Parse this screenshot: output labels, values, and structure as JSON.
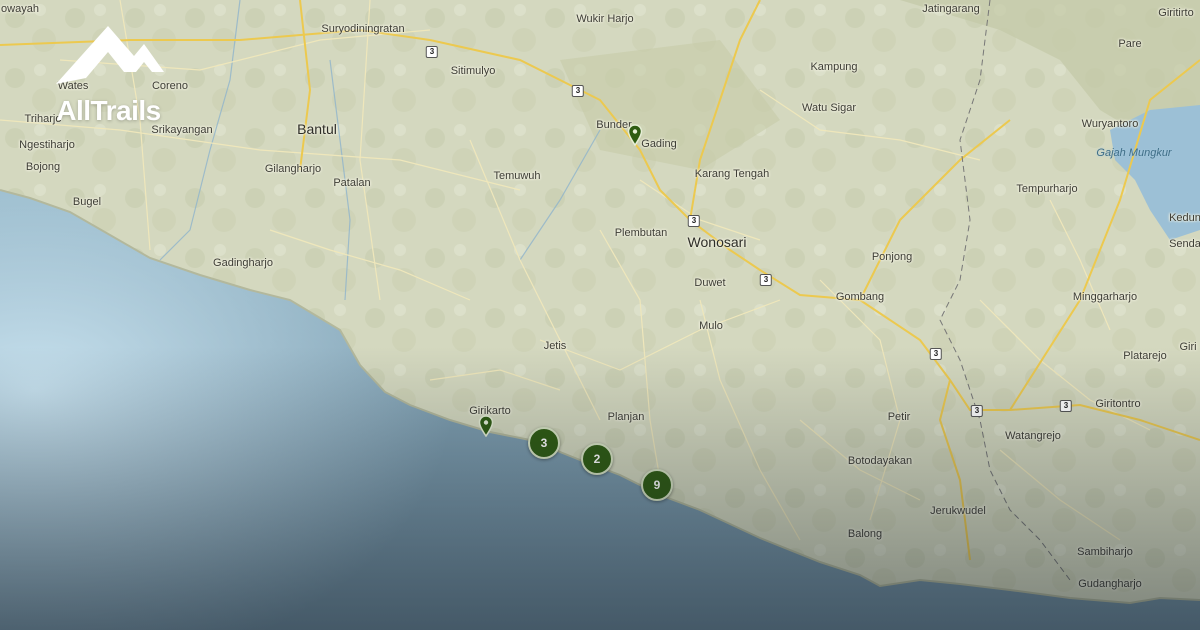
{
  "brand": {
    "name": "AllTrails",
    "logo_icon": "mountain-logo-icon"
  },
  "colors": {
    "ocean": "#8fb6c8",
    "land": "#d8dcc4",
    "road_major": "#f0cf5a",
    "road_minor": "#efe6b8",
    "cluster": "#2f5c12",
    "brand": "#ffffff"
  },
  "places": [
    {
      "id": "suryodiningratan",
      "name": "Suryodiningratan"
    },
    {
      "id": "wukir-harjo",
      "name": "Wukir Harjo"
    },
    {
      "id": "jatingarang",
      "name": "Jatingarang"
    },
    {
      "id": "giritirto",
      "name": "Giritirto"
    },
    {
      "id": "wates",
      "name": "Wates"
    },
    {
      "id": "coreno",
      "name": "Coreno"
    },
    {
      "id": "sitimulyo",
      "name": "Sitimulyo"
    },
    {
      "id": "kampung",
      "name": "Kampung"
    },
    {
      "id": "pare",
      "name": "Pare"
    },
    {
      "id": "triharjo",
      "name": "Triharjo"
    },
    {
      "id": "srikayangan",
      "name": "Srikayangan"
    },
    {
      "id": "bantul",
      "name": "Bantul",
      "big": true
    },
    {
      "id": "watu-sigar",
      "name": "Watu Sigar"
    },
    {
      "id": "bunder",
      "name": "Bunder"
    },
    {
      "id": "gading",
      "name": "Gading"
    },
    {
      "id": "wuryantoro",
      "name": "Wuryantoro"
    },
    {
      "id": "ngestiharjo",
      "name": "Ngestiharjo"
    },
    {
      "id": "gajah-mungkur",
      "name": "Gajah Mungkur",
      "water": true
    },
    {
      "id": "bojong",
      "name": "Bojong"
    },
    {
      "id": "gilangharjo",
      "name": "Gilangharjo"
    },
    {
      "id": "temuwuh",
      "name": "Temuwuh"
    },
    {
      "id": "karang-tengah",
      "name": "Karang Tengah"
    },
    {
      "id": "patalan",
      "name": "Patalan"
    },
    {
      "id": "tempurharjo",
      "name": "Tempurharjo"
    },
    {
      "id": "bugel",
      "name": "Bugel"
    },
    {
      "id": "kedung",
      "name": "Kedun"
    },
    {
      "id": "plembutan",
      "name": "Plembutan"
    },
    {
      "id": "wonosari",
      "name": "Wonosari",
      "big": true
    },
    {
      "id": "senda",
      "name": "Senda"
    },
    {
      "id": "gadingharjo",
      "name": "Gadingharjo"
    },
    {
      "id": "ponjong",
      "name": "Ponjong"
    },
    {
      "id": "duwet",
      "name": "Duwet"
    },
    {
      "id": "gombang",
      "name": "Gombang"
    },
    {
      "id": "minggarharjo",
      "name": "Minggarharjo"
    },
    {
      "id": "mulo",
      "name": "Mulo"
    },
    {
      "id": "jetis",
      "name": "Jetis"
    },
    {
      "id": "platarejo",
      "name": "Platarejo"
    },
    {
      "id": "giri",
      "name": "Giri"
    },
    {
      "id": "giritontro",
      "name": "Giritontro"
    },
    {
      "id": "girikarto",
      "name": "Girikarto"
    },
    {
      "id": "planjan",
      "name": "Planjan"
    },
    {
      "id": "petir",
      "name": "Petir"
    },
    {
      "id": "watangrejo",
      "name": "Watangrejo"
    },
    {
      "id": "botodayakan",
      "name": "Botodayakan"
    },
    {
      "id": "jerukwudel",
      "name": "Jerukwudel"
    },
    {
      "id": "balong",
      "name": "Balong"
    },
    {
      "id": "sambiharjo",
      "name": "Sambiharjo"
    },
    {
      "id": "gudangharjo",
      "name": "Gudangharjo"
    },
    {
      "id": "wawayah",
      "name": "owayah"
    }
  ],
  "route_shields": [
    "3",
    "3",
    "3",
    "3",
    "3",
    "3",
    "3"
  ],
  "clusters": [
    {
      "id": "cluster-a",
      "count": "3"
    },
    {
      "id": "cluster-b",
      "count": "2"
    },
    {
      "id": "cluster-c",
      "count": "9"
    }
  ],
  "pins": [
    {
      "id": "pin-gading"
    },
    {
      "id": "pin-girikarto"
    }
  ]
}
